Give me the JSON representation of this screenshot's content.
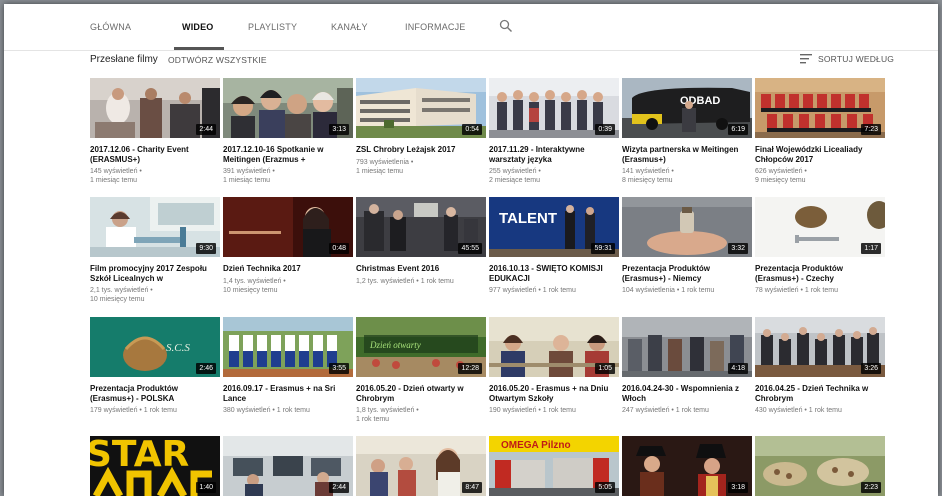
{
  "tabs": [
    {
      "label": "GŁÓWNA"
    },
    {
      "label": "WIDEO"
    },
    {
      "label": "PLAYLISTY"
    },
    {
      "label": "KANAŁY"
    },
    {
      "label": "INFORMACJE"
    }
  ],
  "section": {
    "title": "Przesłane filmy",
    "play_all": "ODTWÓRZ WSZYSTKIE"
  },
  "sort_label": "SORTUJ WEDŁUG",
  "colors": {
    "accent": "#555555",
    "duration_bg": "#000000"
  },
  "videos": [
    {
      "title": "2017.12.06 - Charity Event (ERASMUS+)",
      "views": "145 wyświetleń •",
      "age": "1 miesiąc temu",
      "duration": "2:44"
    },
    {
      "title": "2017.12.10-16 Spotkanie w Meitingen (Erazmus +",
      "views": "391 wyświetleń •",
      "age": "1 miesiąc temu",
      "duration": "3:13"
    },
    {
      "title": "ZSL Chrobry Leżajsk 2017",
      "views": "793 wyświetlenia •",
      "age": "1 miesiąc temu",
      "duration": "0:54"
    },
    {
      "title": "2017.11.29 - Interaktywne warsztaty języka",
      "views": "255 wyświetleń •",
      "age": "2 miesiące temu",
      "duration": "0:39"
    },
    {
      "title": "Wizyta partnerska w Meitingen (Erasmus+)",
      "views": "141 wyświetleń •",
      "age": "8 miesięcy temu",
      "duration": "6:19"
    },
    {
      "title": "Finał Wojewódzki Licealiady Chłopców 2017",
      "views": "626 wyświetleń •",
      "age": "9 miesięcy temu",
      "duration": "7:23"
    },
    {
      "title": "Film promocyjny 2017 Zespołu Szkół Licealnych w",
      "views": "2,1 tys. wyświetleń •",
      "age": "10 miesięcy temu",
      "duration": "9:30"
    },
    {
      "title": "Dzień Technika 2017",
      "views": "1,4 tys. wyświetleń •",
      "age": "10 miesięcy temu",
      "duration": "0:48"
    },
    {
      "title": "Christmas Event 2016",
      "views": "1,2 tys. wyświetleń • 1 rok temu",
      "age": "",
      "duration": "45:55"
    },
    {
      "title": "2016.10.13 - ŚWIĘTO KOMISJI EDUKACJI",
      "views": "977 wyświetleń • 1 rok temu",
      "age": "",
      "duration": "59:31"
    },
    {
      "title": "Prezentacja Produktów (Erasmus+) - Niemcy",
      "views": "104 wyświetlenia • 1 rok temu",
      "age": "",
      "duration": "3:32"
    },
    {
      "title": "Prezentacja Produktów (Erasmus+) - Czechy",
      "views": "78 wyświetleń • 1 rok temu",
      "age": "",
      "duration": "1:17"
    },
    {
      "title": "Prezentacja Produktów (Erasmus+) - POLSKA",
      "views": "179 wyświetleń • 1 rok temu",
      "age": "",
      "duration": "2:46"
    },
    {
      "title": "2016.09.17 - Erasmus + na Sri Lance",
      "views": "380 wyświetleń • 1 rok temu",
      "age": "",
      "duration": "3:55"
    },
    {
      "title": "2016.05.20 - Dzień otwarty w Chrobrym",
      "views": "1,8 tys. wyświetleń •",
      "age": "1 rok temu",
      "duration": "12:28"
    },
    {
      "title": "2016.05.20 - Erasmus + na Dniu Otwartym Szkoły",
      "views": "190 wyświetleń • 1 rok temu",
      "age": "",
      "duration": "1:05"
    },
    {
      "title": "2016.04.24-30 - Wspomnienia z Włoch",
      "views": "247 wyświetleń • 1 rok temu",
      "age": "",
      "duration": "4:18"
    },
    {
      "title": "2016.04.25 - Dzień Technika w Chrobrym",
      "views": "430 wyświetleń • 1 rok temu",
      "age": "",
      "duration": "3:26"
    },
    {
      "title": "",
      "views": "",
      "age": "",
      "duration": "1:40"
    },
    {
      "title": "",
      "views": "",
      "age": "",
      "duration": "2:44"
    },
    {
      "title": "",
      "views": "",
      "age": "",
      "duration": "8:47"
    },
    {
      "title": "",
      "views": "",
      "age": "",
      "duration": "5:05"
    },
    {
      "title": "",
      "views": "",
      "age": "",
      "duration": "3:18"
    },
    {
      "title": "",
      "views": "",
      "age": "",
      "duration": "2:23"
    }
  ],
  "thumb_text": {
    "bus": "ODBAD",
    "talent": "TALENT",
    "omega": "OMEGA Pilzno",
    "star": "STAR"
  }
}
